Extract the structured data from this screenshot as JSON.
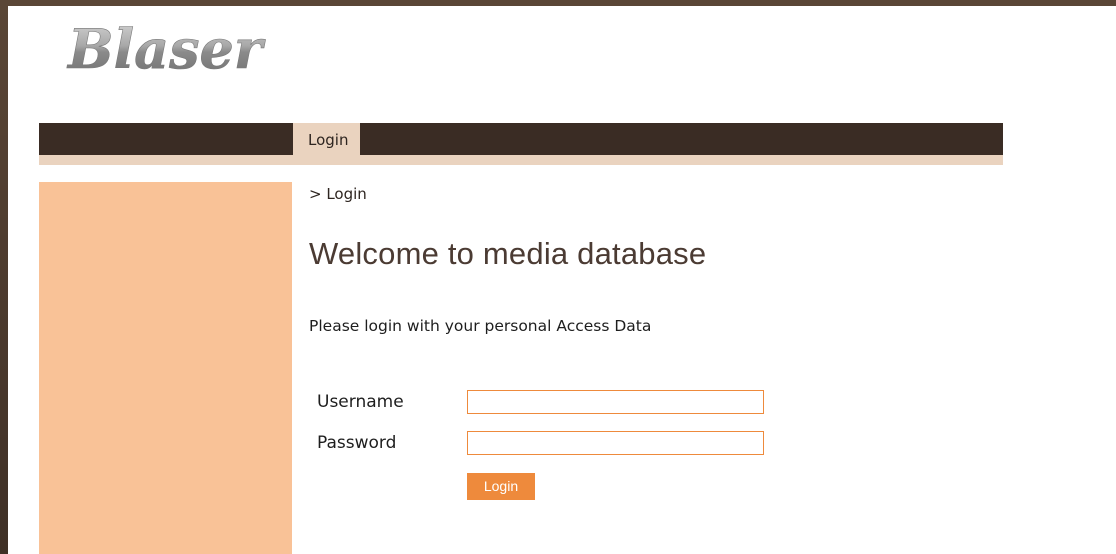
{
  "header": {
    "logo_text": "Blaser"
  },
  "nav": {
    "tabs": [
      {
        "label": "Login",
        "active": true
      }
    ]
  },
  "breadcrumb": {
    "text": "> Login"
  },
  "main": {
    "title": "Welcome to media database",
    "intro": "Please login with your personal Access Data"
  },
  "form": {
    "username_label": "Username",
    "username_value": "",
    "password_label": "Password",
    "password_value": "",
    "submit_label": "Login"
  },
  "colors": {
    "frame_background": "#4a3a2e",
    "navbar": "#3a2c24",
    "active_tab": "#ead3bf",
    "sidebar": "#f9c297",
    "accent": "#ee8a3c",
    "title_text": "#4b3b33"
  }
}
